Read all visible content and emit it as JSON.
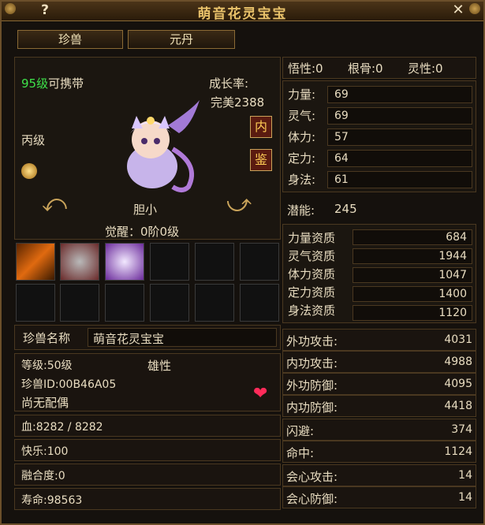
{
  "window": {
    "title": "萌音花灵宝宝",
    "help": "?",
    "close": "✕"
  },
  "tabs": [
    {
      "label": "珍兽"
    },
    {
      "label": "元丹"
    }
  ],
  "pet": {
    "level_text": "95级",
    "carry_text": "可携带",
    "grade": "丙级",
    "growth_label": "成长率:",
    "growth_value": "完美2388",
    "nature": "胆小",
    "awaken": "觉醒：0阶0级",
    "btn_inner": "内",
    "btn_appraise": "鉴",
    "name_label": "珍兽名称",
    "name_value": "萌音花灵宝宝",
    "info_level": "等级:50级",
    "info_gender": "雄性",
    "info_id": "珍兽ID:00B46A05",
    "info_mate": "尚无配偶",
    "hp": "血:8282 / 8282",
    "happy": "快乐:100",
    "fusion": "融合度:0",
    "life": "寿命:98563"
  },
  "traits": {
    "wuxing": "悟性:0",
    "gengu": "根骨:0",
    "lingxing": "灵性:0"
  },
  "base_stats": [
    {
      "label": "力量:",
      "value": "69"
    },
    {
      "label": "灵气:",
      "value": "69"
    },
    {
      "label": "体力:",
      "value": "57"
    },
    {
      "label": "定力:",
      "value": "64"
    },
    {
      "label": "身法:",
      "value": "61"
    }
  ],
  "potential": {
    "label": "潜能:",
    "value": "245"
  },
  "aptitude": [
    {
      "label": "力量资质",
      "value": "684"
    },
    {
      "label": "灵气资质",
      "value": "1944"
    },
    {
      "label": "体力资质",
      "value": "1047"
    },
    {
      "label": "定力资质",
      "value": "1400"
    },
    {
      "label": "身法资质",
      "value": "1120"
    }
  ],
  "combat": [
    {
      "label": "外功攻击:",
      "value": "4031"
    },
    {
      "label": "内功攻击:",
      "value": "4988"
    },
    {
      "label": "外功防御:",
      "value": "4095"
    },
    {
      "label": "内功防御:",
      "value": "4418"
    },
    {
      "label": "闪避:",
      "value": "374"
    },
    {
      "label": "命中:",
      "value": "1124"
    },
    {
      "label": "会心攻击:",
      "value": "14"
    },
    {
      "label": "会心防御:",
      "value": "14"
    }
  ],
  "icons": {
    "left_arrow": "arrow-left-icon",
    "right_arrow": "arrow-right-icon",
    "heart": "heart-icon",
    "gem": "gem-icon"
  },
  "colors": {
    "green": "#3ee24a",
    "cyan": "#4fb7ff",
    "magenta": "#e84ae8",
    "gold": "#e9c26a"
  }
}
